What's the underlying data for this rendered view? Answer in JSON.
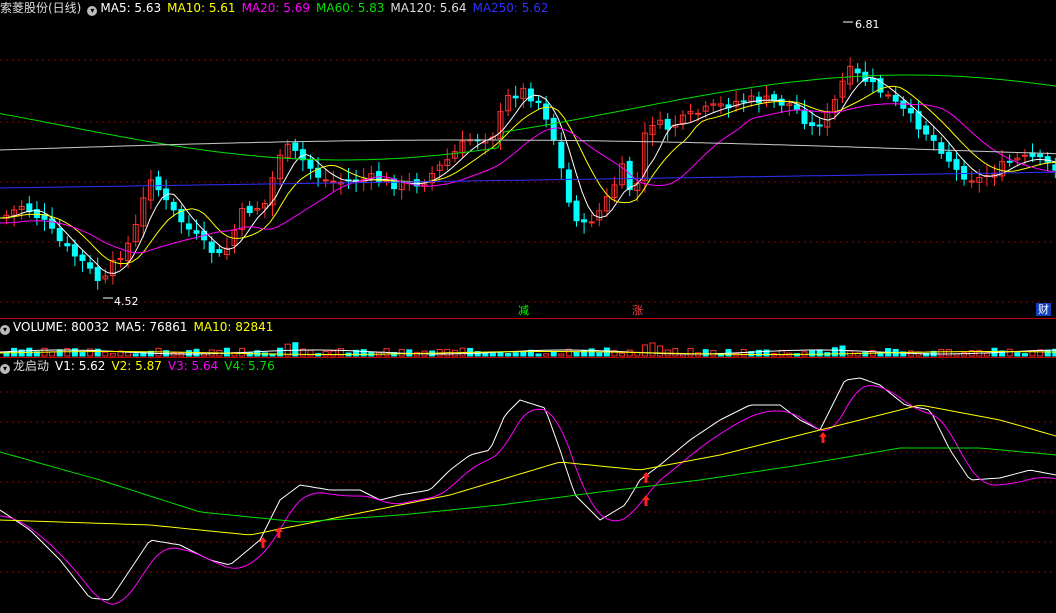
{
  "price_panel": {
    "stock_name": "索菱股份(日线)",
    "ma": [
      {
        "label": "MA5: 5.63",
        "color": "#ffffff"
      },
      {
        "label": "MA10: 5.61",
        "color": "#ffff00"
      },
      {
        "label": "MA20: 5.69",
        "color": "#ff00ff"
      },
      {
        "label": "MA60: 5.83",
        "color": "#00e000"
      },
      {
        "label": "MA120: 5.64",
        "color": "#dddddd"
      },
      {
        "label": "MA250: 5.62",
        "color": "#3030ff"
      }
    ],
    "high_label": "6.81",
    "low_label": "4.52",
    "tags": [
      {
        "text": "减",
        "color": "#00ff00",
        "bg": "#003300"
      },
      {
        "text": "涨",
        "color": "#ff4040",
        "bg": "#330000"
      },
      {
        "text": "财",
        "color": "#ffffff",
        "bg": "#0033aa"
      }
    ]
  },
  "volume_panel": {
    "items": [
      {
        "label": "VOLUME: 80032",
        "color": "#ffffff"
      },
      {
        "label": "MA5: 76861",
        "color": "#ffffff"
      },
      {
        "label": "MA10: 82841",
        "color": "#ffff00"
      }
    ]
  },
  "indicator_panel": {
    "name": "龙启动",
    "items": [
      {
        "label": "V1: 5.62",
        "color": "#ffffff"
      },
      {
        "label": "V2: 5.87",
        "color": "#ffff00"
      },
      {
        "label": "V3: 5.64",
        "color": "#ff00ff"
      },
      {
        "label": "V4: 5.76",
        "color": "#00e000"
      }
    ]
  },
  "colors": {
    "up": "#ff3030",
    "down": "#00ffff",
    "grid": "#8b0000"
  }
}
